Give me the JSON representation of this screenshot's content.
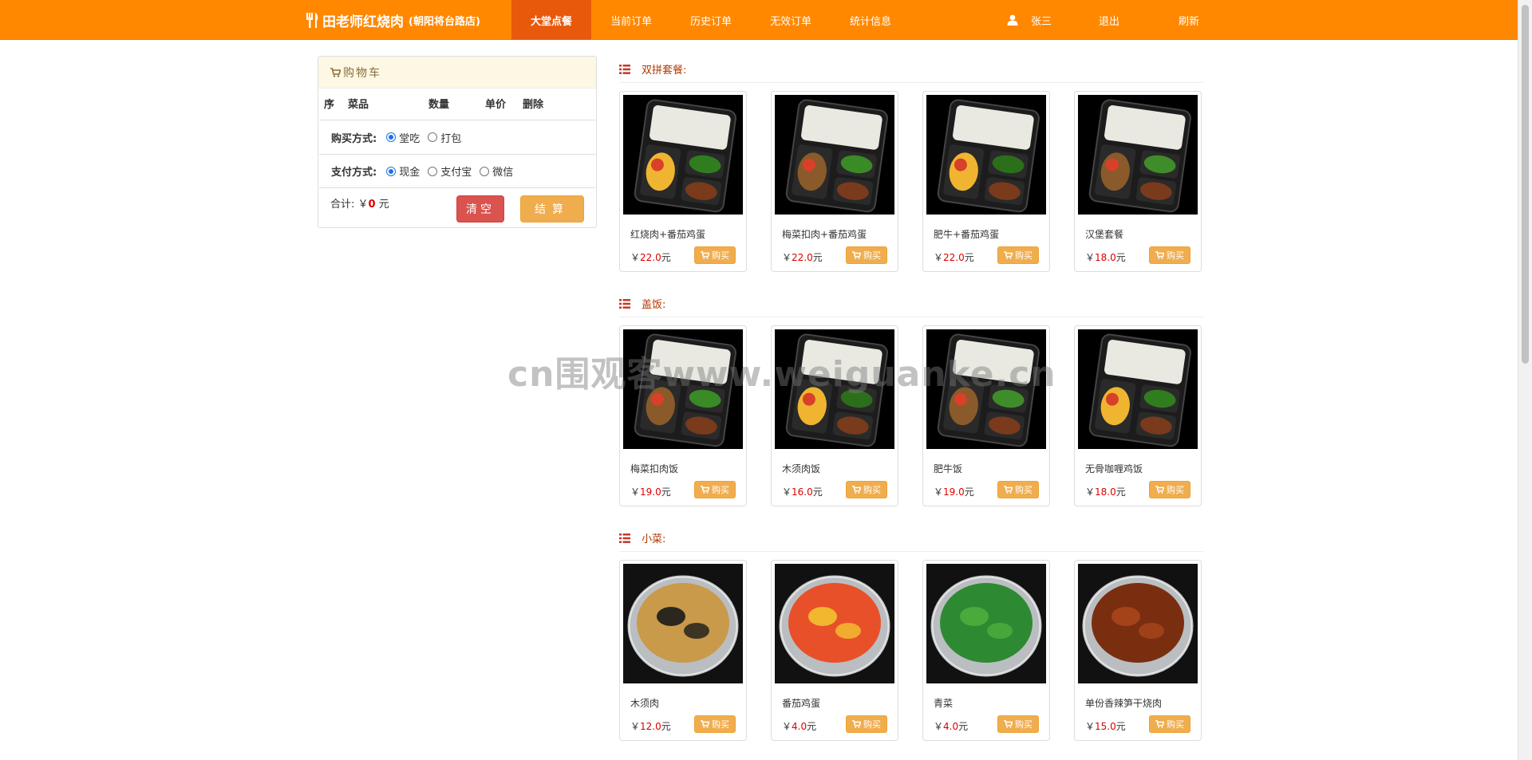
{
  "brand": {
    "name": "田老师红烧肉",
    "branch": "(朝阳将台路店)"
  },
  "nav": {
    "items": [
      {
        "label": "大堂点餐",
        "active": true
      },
      {
        "label": "当前订单",
        "active": false
      },
      {
        "label": "历史订单",
        "active": false
      },
      {
        "label": "无效订单",
        "active": false
      },
      {
        "label": "统计信息",
        "active": false
      }
    ],
    "user": "张三",
    "logout": "退出",
    "refresh": "刷新"
  },
  "cart": {
    "title": "购物车",
    "columns": [
      "序",
      "菜品",
      "数量",
      "单价",
      "删除"
    ],
    "purchase_label": "购买方式:",
    "purchase_options": [
      {
        "label": "堂吃",
        "checked": true
      },
      {
        "label": "打包",
        "checked": false
      }
    ],
    "payment_label": "支付方式:",
    "payment_options": [
      {
        "label": "现金",
        "checked": true
      },
      {
        "label": "支付宝",
        "checked": false
      },
      {
        "label": "微信",
        "checked": false
      }
    ],
    "total_prefix": "合计: ￥",
    "total_value": "0",
    "total_unit": "元",
    "clear_label": "清空",
    "checkout_label": "结算"
  },
  "sections": [
    {
      "title": "双拼套餐:",
      "items": [
        {
          "name": "红烧肉+番茄鸡蛋",
          "price": "22.0",
          "image": "bento-dark-tray"
        },
        {
          "name": "梅菜扣肉+番茄鸡蛋",
          "price": "22.0",
          "image": "bento-dark-tray"
        },
        {
          "name": "肥牛+番茄鸡蛋",
          "price": "22.0",
          "image": "bento-dark-tray"
        },
        {
          "name": "汉堡套餐",
          "price": "18.0",
          "image": "bento-dark-tray"
        }
      ]
    },
    {
      "title": "盖饭:",
      "items": [
        {
          "name": "梅菜扣肉饭",
          "price": "19.0",
          "image": "bento-dark-tray"
        },
        {
          "name": "木须肉饭",
          "price": "16.0",
          "image": "bento-dark-tray"
        },
        {
          "name": "肥牛饭",
          "price": "19.0",
          "image": "bento-dark-tray"
        },
        {
          "name": "无骨咖喱鸡饭",
          "price": "18.0",
          "image": "bento-dark-tray"
        }
      ]
    },
    {
      "title": "小菜:",
      "items": [
        {
          "name": "木须肉",
          "price": "12.0",
          "image": "clear-bowl"
        },
        {
          "name": "番茄鸡蛋",
          "price": "4.0",
          "image": "clear-bowl"
        },
        {
          "name": "青菜",
          "price": "4.0",
          "image": "clear-bowl"
        },
        {
          "name": "单份香辣笋干烧肉",
          "price": "15.0",
          "image": "clear-bowl"
        }
      ]
    }
  ],
  "buy_label": "购买",
  "currency_symbol": "￥",
  "price_unit": "元",
  "watermark": "cn围观客www.weiguanke.cn",
  "colors": {
    "nav": "#ff8800",
    "nav_active": "#e8590c",
    "price": "#dd0000",
    "buy": "#f0ad4e",
    "clear": "#d9534f"
  }
}
